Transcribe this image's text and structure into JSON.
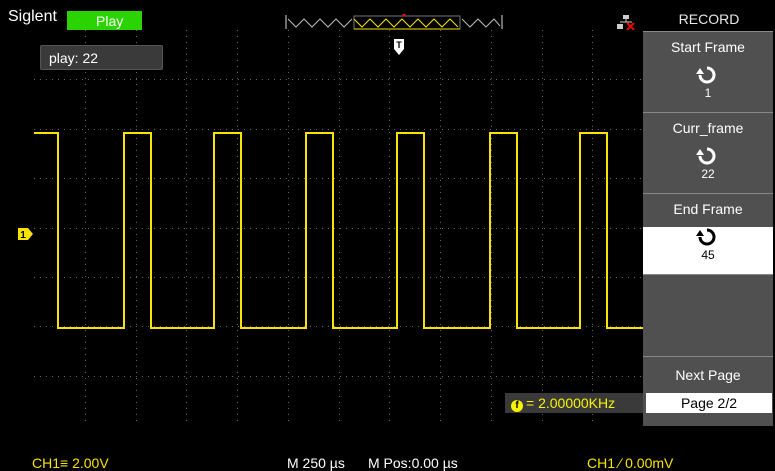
{
  "header": {
    "brand": "Siglent",
    "mode_badge": "Play"
  },
  "screen": {
    "play_label": "play: 22",
    "frequency": "= 2.00000KHz",
    "trigger_marker": "T",
    "ch1_marker": "1"
  },
  "menu": {
    "title": "RECORD",
    "start_frame": {
      "label": "Start Frame",
      "value": "1"
    },
    "curr_frame": {
      "label": "Curr_frame",
      "value": "22"
    },
    "end_frame": {
      "label": "End Frame",
      "value": "45"
    },
    "next_page": "Next Page",
    "page": "Page 2/2"
  },
  "status": {
    "ch1_scale": "CH1≡ 2.00V",
    "timebase": "M 250 µs",
    "mpos": "M Pos:0.00 µs",
    "trigger": "CH1 ∕ 0.00mV"
  },
  "colors": {
    "ch1": "#f8e200",
    "badge": "#2bd300",
    "menu_bg": "#505050"
  }
}
